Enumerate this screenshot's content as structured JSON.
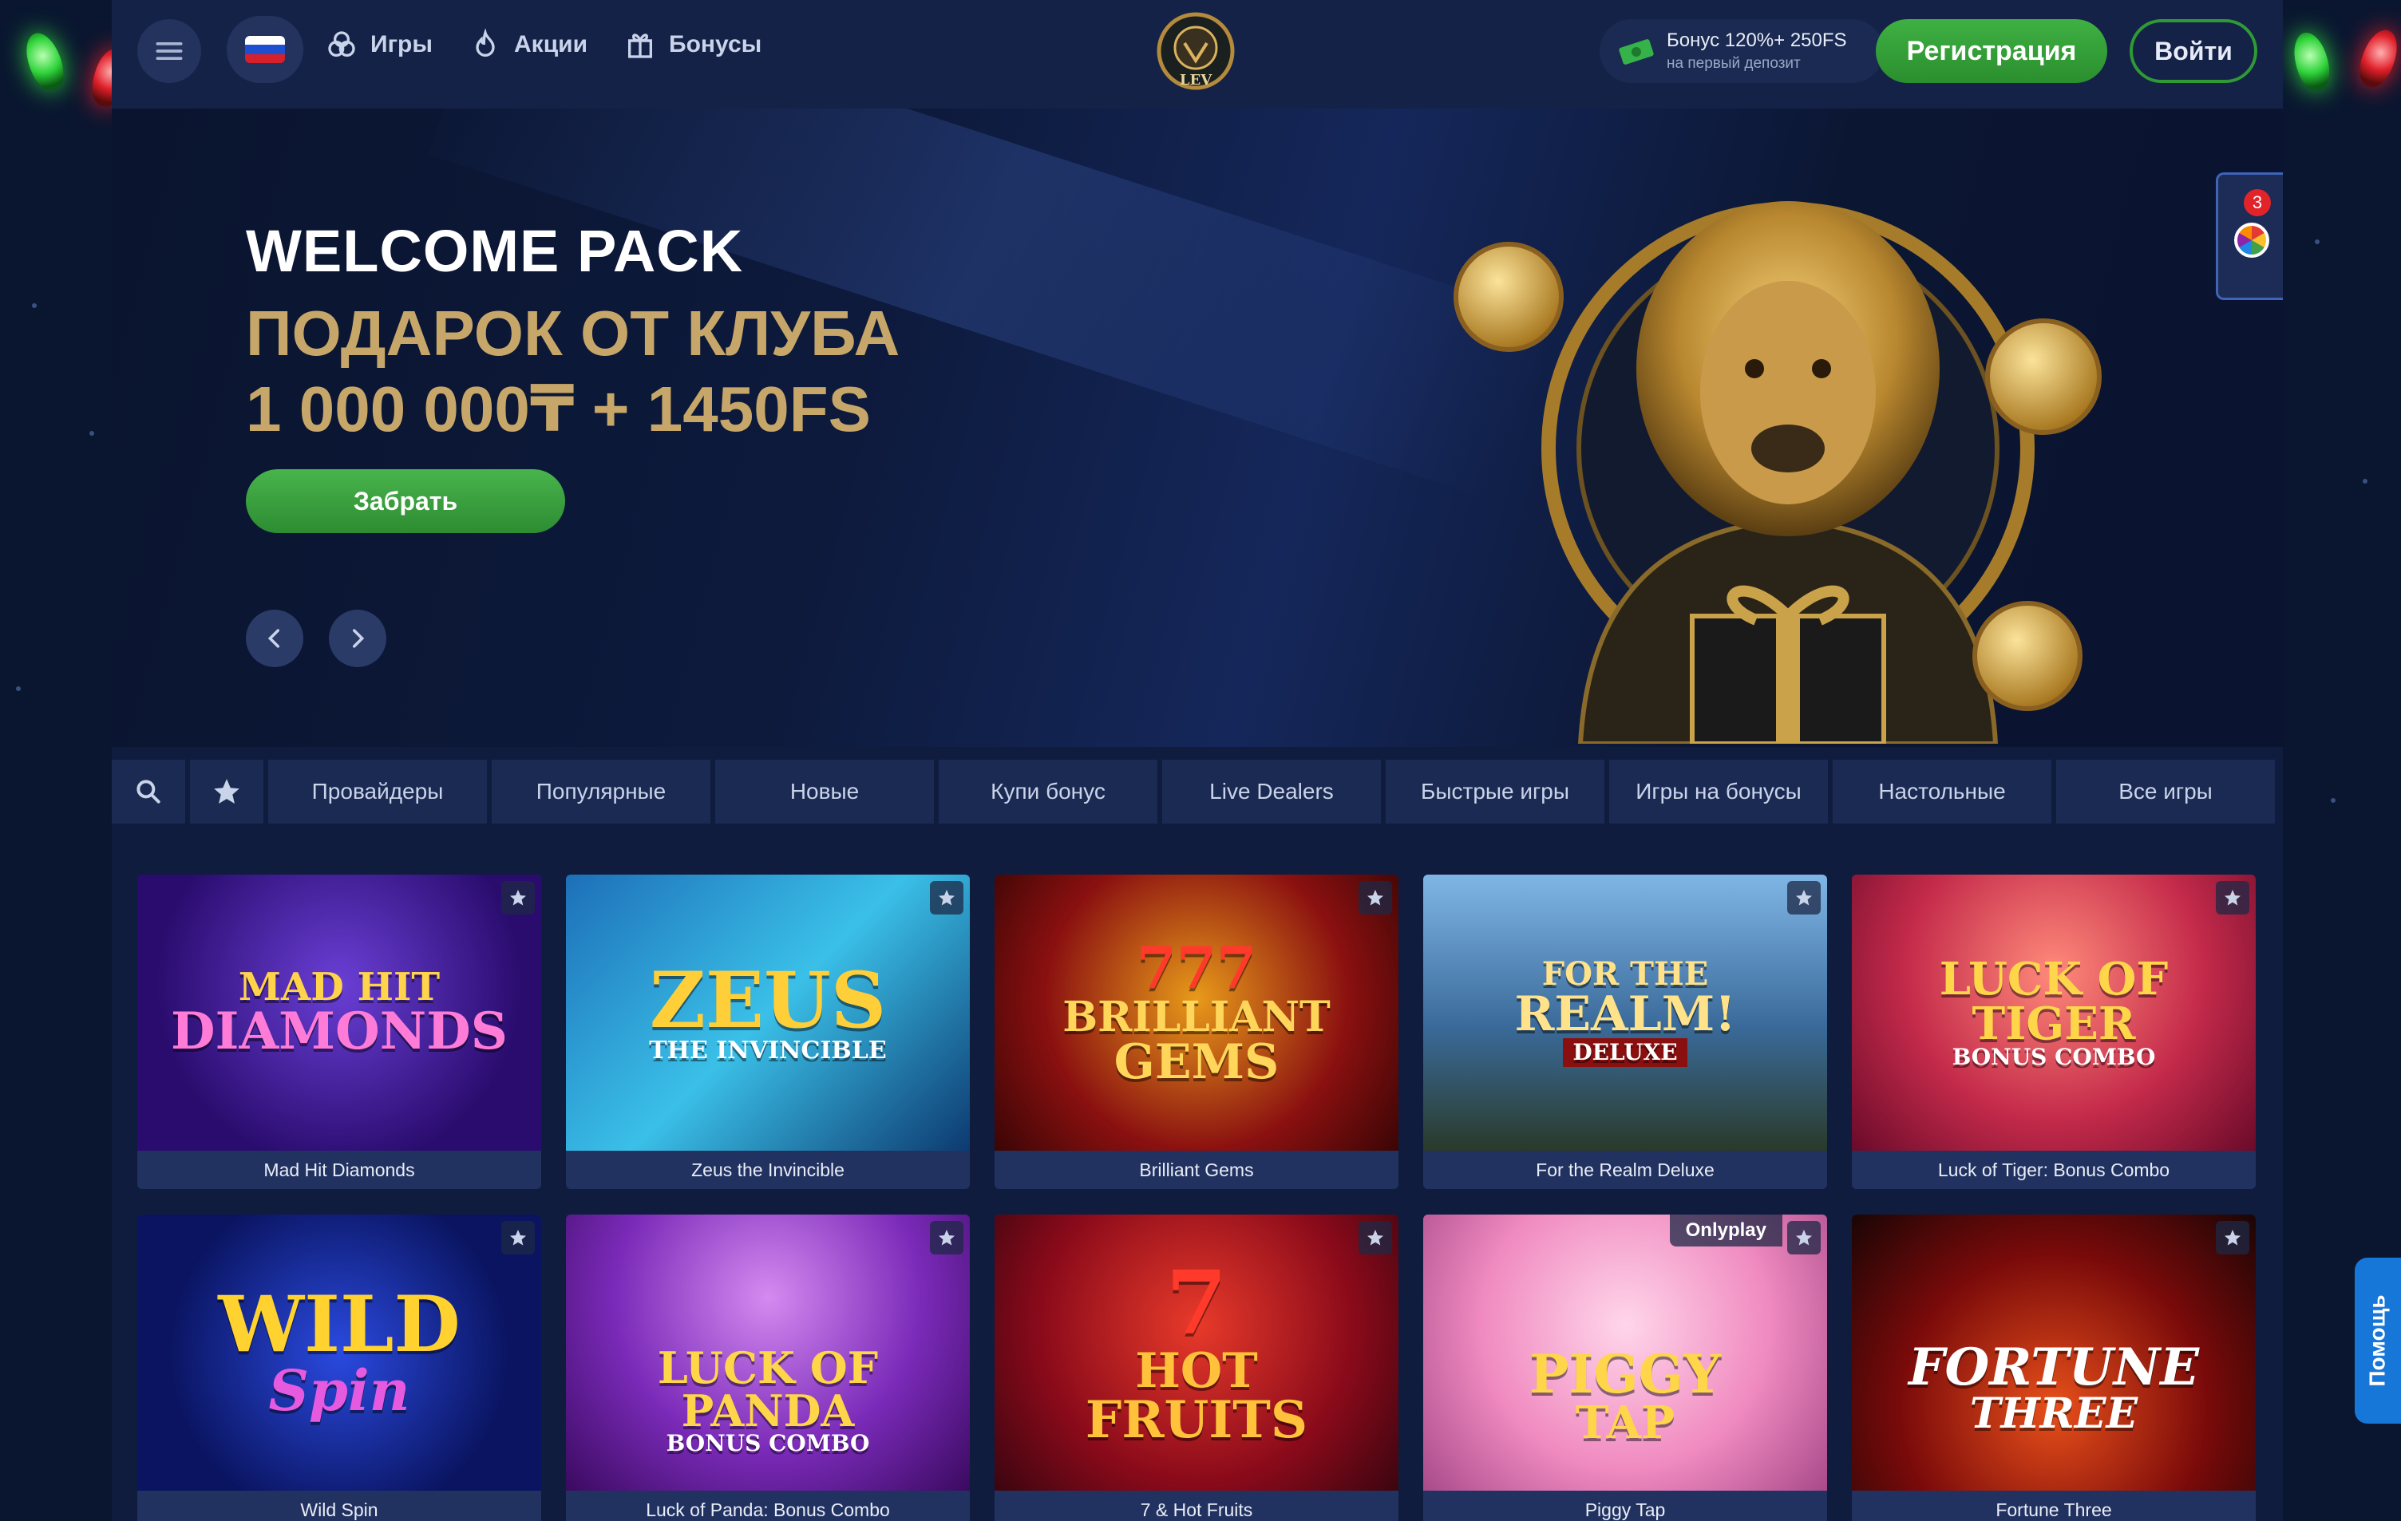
{
  "header": {
    "nav": [
      {
        "label": "Игры",
        "icon": "cards-icon"
      },
      {
        "label": "Акции",
        "icon": "fire-icon"
      },
      {
        "label": "Бонусы",
        "icon": "gift-icon"
      }
    ],
    "logo_text": "LEV",
    "bonus_line1": "Бонус 120%+ 250FS",
    "bonus_line2": "на первый депозит",
    "register_label": "Регистрация",
    "login_label": "Войти"
  },
  "hero": {
    "title": "WELCOME PACK",
    "subtitle1": "ПОДАРОК ОТ КЛУБА",
    "subtitle2": "1 000 000₸ + 1450FS",
    "cta_label": "Забрать"
  },
  "widget": {
    "badge_count": "3"
  },
  "categories": [
    "Провайдеры",
    "Популярные",
    "Новые",
    "Купи бонус",
    "Live Dealers",
    "Быстрые игры",
    "Игры на бонусы",
    "Настольные",
    "Все игры"
  ],
  "games": [
    {
      "name": "Mad Hit Diamonds",
      "art1": "MAD HIT",
      "art2": "DIAMONDS",
      "art3": "",
      "provider": ""
    },
    {
      "name": "Zeus the Invincible",
      "art1": "ZEUS",
      "art2": "THE INVINCIBLE",
      "art3": "",
      "provider": ""
    },
    {
      "name": "Brilliant Gems",
      "art1": "777",
      "art2": "BRILLIANT",
      "art3": "GEMS",
      "provider": ""
    },
    {
      "name": "For the Realm Deluxe",
      "art1": "FOR THE",
      "art2": "REALM!",
      "art3": "DELUXE",
      "provider": ""
    },
    {
      "name": "Luck of Tiger: Bonus Combo",
      "art1": "LUCK OF TIGER",
      "art2": "BONUS COMBO",
      "art3": "",
      "provider": ""
    },
    {
      "name": "Wild Spin",
      "art1": "WILD",
      "art2": "Spin",
      "art3": "",
      "provider": ""
    },
    {
      "name": "Luck of Panda: Bonus Combo",
      "art1": "LUCK OF PANDA",
      "art2": "BONUS COMBO",
      "art3": "",
      "provider": ""
    },
    {
      "name": "7 & Hot Fruits",
      "art1": "7",
      "art2": "HOT",
      "art3": "FRUITS",
      "provider": ""
    },
    {
      "name": "Piggy Tap",
      "art1": "PIGGY",
      "art2": "TAP",
      "art3": "",
      "provider": "Onlyplay"
    },
    {
      "name": "Fortune Three",
      "art1": "FORTUNE",
      "art2": "THREE",
      "art3": "",
      "provider": ""
    }
  ],
  "help_label": "Помощь",
  "colors": {
    "accent_green": "#3fb043",
    "gold": "#c7a769",
    "panel": "#1b2a52",
    "bg": "#0a1630"
  }
}
